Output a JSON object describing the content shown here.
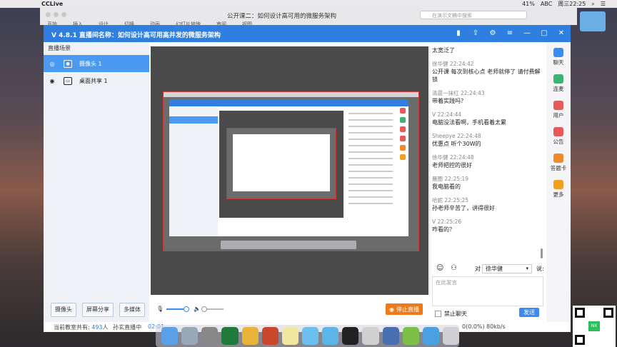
{
  "menubar": {
    "app": "CCLive",
    "battery": "41%",
    "input": "ABC",
    "clock": "周三22:25"
  },
  "bgapp": {
    "doc_title": "公开课二：如何设计高可用的微服务架构",
    "search_placeholder": "在演示文稿中搜索",
    "menus": [
      "开始",
      "插入",
      "设计",
      "切换",
      "动画",
      "幻灯片放映",
      "审阅",
      "视图"
    ]
  },
  "window": {
    "title": "V 4.8.1  直播间名称：如何设计高可用高并发的微服务架构"
  },
  "scenes": {
    "header": "直播场景",
    "items": [
      {
        "label": "摄像头 1",
        "active": true
      },
      {
        "label": "桌面共享 1",
        "active": false
      }
    ]
  },
  "left_buttons": [
    "摄像头",
    "屏幕分享",
    "多媒体"
  ],
  "chat": {
    "messages": [
      {
        "who": "",
        "text": "太宽泛了"
      },
      {
        "who": "徐华健 22:24:42",
        "text": "公开课 每次到核心点 老师就停了 请付费解锁"
      },
      {
        "who": "清晨一抹红 22:24:43",
        "text": "带着实践吗？"
      },
      {
        "who": "V 22:24:44",
        "text": "电脑没法看啊，手机看着太累"
      },
      {
        "who": "Sheepye 22:24:48",
        "text": "优惠点 听个30W的"
      },
      {
        "who": "徐华健 22:24:48",
        "text": "老师把控的很好"
      },
      {
        "who": "雁圈 22:25:19",
        "text": "我电脑看的"
      },
      {
        "who": "哈妮 22:25:25",
        "text": "孙老师辛苦了，讲得很好"
      },
      {
        "who": "V 22:25:26",
        "text": "咋看的？"
      }
    ],
    "to_label": "对",
    "target": "徐华健",
    "say_label": "说:",
    "input_placeholder": "在此发言",
    "ban_label": "禁止聊天",
    "send_label": "发送"
  },
  "iconbar": [
    {
      "label": "聊天",
      "color": "#3b8cf0"
    },
    {
      "label": "连麦",
      "color": "#3cb371"
    },
    {
      "label": "用户",
      "color": "#e85a5a"
    },
    {
      "label": "公告",
      "color": "#e85a5a"
    },
    {
      "label": "答题卡",
      "color": "#f08a2a"
    },
    {
      "label": "更多",
      "color": "#f0a020"
    }
  ],
  "stop_label": "停止直播",
  "status": {
    "online_prefix": "当前教室共有:",
    "online_count": "493",
    "online_suffix": "人",
    "streaming": "孙玄直播中",
    "time": "02:01",
    "loss": "0(0.0%)",
    "speed": "80kb/s"
  },
  "qr": {
    "badge": "NX"
  }
}
